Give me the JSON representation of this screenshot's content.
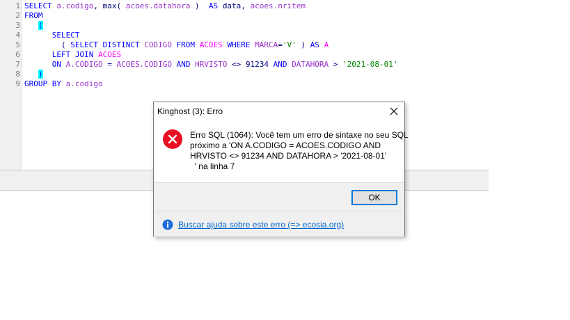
{
  "editor": {
    "line_numbers": [
      "1",
      "2",
      "3",
      "4",
      "5",
      "6",
      "7",
      "8",
      "9"
    ],
    "lines": [
      [
        {
          "t": "SELECT ",
          "c": "kw"
        },
        {
          "t": "a.codigo",
          "c": "id2"
        },
        {
          "t": ", ",
          "c": "op"
        },
        {
          "t": "max",
          "c": "fn"
        },
        {
          "t": "( ",
          "c": "op"
        },
        {
          "t": "acoes.datahora",
          "c": "id2"
        },
        {
          "t": " )  ",
          "c": "op"
        },
        {
          "t": "AS ",
          "c": "kw"
        },
        {
          "t": "data",
          "c": "fn"
        },
        {
          "t": ", ",
          "c": "op"
        },
        {
          "t": "acoes.nritem",
          "c": "id2"
        }
      ],
      [
        {
          "t": "FROM",
          "c": "kw"
        }
      ],
      [
        {
          "t": "   ",
          "c": "op"
        },
        {
          "t": "(",
          "c": "paren"
        }
      ],
      [
        {
          "t": "      SELECT",
          "c": "kw"
        }
      ],
      [
        {
          "t": "        ( ",
          "c": "op"
        },
        {
          "t": "SELECT DISTINCT ",
          "c": "kw"
        },
        {
          "t": "CODIGO ",
          "c": "id2"
        },
        {
          "t": "FROM ",
          "c": "kw"
        },
        {
          "t": "ACOES ",
          "c": "tb"
        },
        {
          "t": "WHERE ",
          "c": "kw"
        },
        {
          "t": "MARCA",
          "c": "id2"
        },
        {
          "t": "=",
          "c": "op"
        },
        {
          "t": "'V'",
          "c": "str"
        },
        {
          "t": " ) ",
          "c": "op"
        },
        {
          "t": "AS ",
          "c": "kw"
        },
        {
          "t": "A",
          "c": "tb"
        }
      ],
      [
        {
          "t": "      LEFT JOIN ",
          "c": "kw"
        },
        {
          "t": "ACOES",
          "c": "tb"
        }
      ],
      [
        {
          "t": "      ON ",
          "c": "kw"
        },
        {
          "t": "A.CODIGO",
          "c": "id2"
        },
        {
          "t": " = ",
          "c": "op"
        },
        {
          "t": "ACOES.CODIGO",
          "c": "id2"
        },
        {
          "t": " AND ",
          "c": "kw"
        },
        {
          "t": "HRVISTO",
          "c": "id2"
        },
        {
          "t": " <> ",
          "c": "op"
        },
        {
          "t": "91234",
          "c": "num"
        },
        {
          "t": " AND ",
          "c": "kw"
        },
        {
          "t": "DATAHORA",
          "c": "id2"
        },
        {
          "t": " > ",
          "c": "op"
        },
        {
          "t": "'2021-08-01'",
          "c": "str"
        }
      ],
      [
        {
          "t": "   ",
          "c": "op"
        },
        {
          "t": ")",
          "c": "paren"
        }
      ],
      [
        {
          "t": "GROUP BY ",
          "c": "kw"
        },
        {
          "t": "a.codigo",
          "c": "id2"
        }
      ]
    ]
  },
  "dialog": {
    "title": "Kinghost (3): Erro",
    "message": "Erro SQL (1064): Você tem um erro de sintaxe no seu SQL\npróximo a 'ON A.CODIGO = ACOES.CODIGO AND\nHRVISTO <> 91234 AND DATAHORA > '2021-08-01'\n  ' na linha 7",
    "ok_label": "OK",
    "help_link": "Buscar ajuda sobre este erro (=> ecosia.org)",
    "icons": {
      "error": "error-x-circle-icon",
      "info": "info-icon",
      "close": "close-icon"
    },
    "colors": {
      "error_red": "#e81123",
      "info_blue": "#1e6fd9",
      "link_blue": "#0066cc",
      "accent": "#0078d7"
    }
  }
}
